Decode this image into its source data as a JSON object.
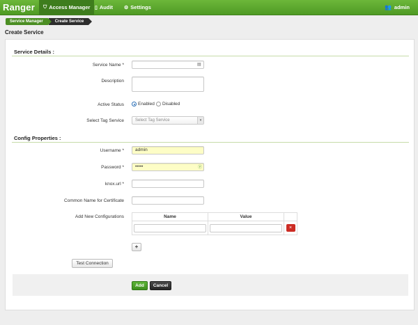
{
  "app": {
    "brand": "Ranger"
  },
  "nav": [
    {
      "label": "Access Manager",
      "icon": "shield-icon"
    },
    {
      "label": "Audit",
      "icon": "document-icon"
    },
    {
      "label": "Settings",
      "icon": "gear-icon"
    }
  ],
  "user": {
    "name": "admin",
    "icon": "users-icon"
  },
  "breadcrumb": [
    "Service Manager",
    "Create Service"
  ],
  "page_title": "Create Service",
  "service_details": {
    "title": "Service Details :",
    "service_name": {
      "label": "Service Name *",
      "value": ""
    },
    "description": {
      "label": "Description",
      "value": ""
    },
    "active_status": {
      "label": "Active Status",
      "options": [
        "Enabled",
        "Disabled"
      ],
      "selected": "Enabled"
    },
    "tag_service": {
      "label": "Select Tag Service",
      "placeholder": "Select Tag Service"
    }
  },
  "config": {
    "title": "Config Properties :",
    "username": {
      "label": "Username *",
      "value": "admin"
    },
    "password": {
      "label": "Password *",
      "value": "•••••"
    },
    "knox_url": {
      "label": "knox.url *",
      "value": ""
    },
    "common_name": {
      "label": "Common Name for Certificate",
      "value": ""
    },
    "add_new": {
      "label": "Add New Configurations",
      "headers": [
        "Name",
        "Value"
      ],
      "delete_glyph": "×",
      "add_glyph": "+"
    }
  },
  "buttons": {
    "test_connection": "Test Connection",
    "add": "Add",
    "cancel": "Cancel"
  },
  "colors": {
    "brand_green": "#4f9a24",
    "delete_red": "#cc2c24",
    "field_highlight": "#fdfdc6"
  }
}
